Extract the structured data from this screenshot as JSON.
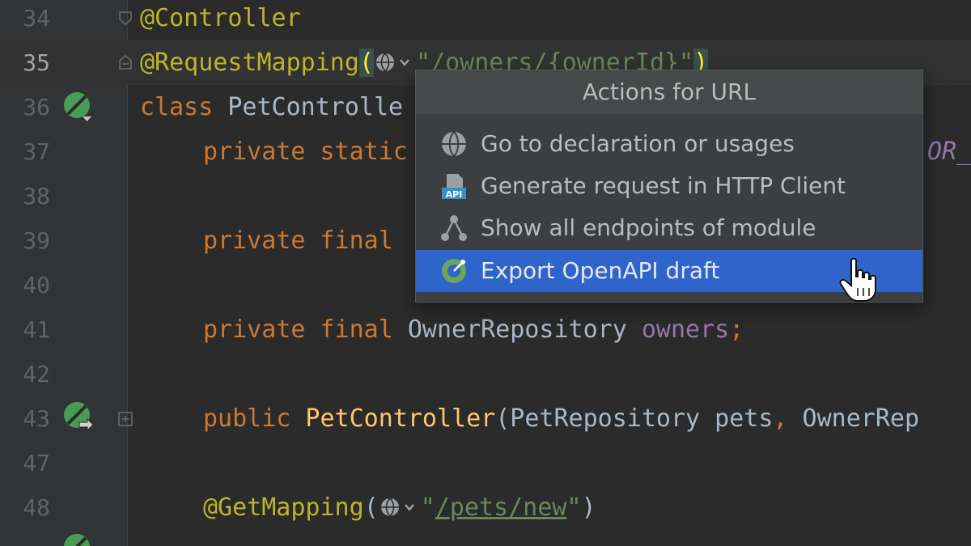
{
  "editor": {
    "lines": [
      {
        "num": "34",
        "t1": "@Controller"
      },
      {
        "num": "35",
        "t1": "@RequestMapping",
        "t2": "(",
        "t3": "\"",
        "url": "/owners/{ownerId}",
        "t4": "\"",
        "t5": ")"
      },
      {
        "num": "36",
        "t1": "class",
        "t2": " PetControlle"
      },
      {
        "num": "37",
        "t1": "private",
        "t2": " static",
        "tail": "OR_"
      },
      {
        "num": "38"
      },
      {
        "num": "39",
        "t1": "private",
        "t2": " final"
      },
      {
        "num": "40"
      },
      {
        "num": "41",
        "t1": "private",
        "t2": " final",
        "t3": " OwnerRepository ",
        "t4": "owners",
        "t5": ";"
      },
      {
        "num": "42"
      },
      {
        "num": "43",
        "t1": "public",
        "t2": " PetController",
        "t3": "(PetRepository pets",
        "t4": ",",
        "t5": " OwnerRep"
      },
      {
        "num": "47"
      },
      {
        "num": "48",
        "t1": "@GetMapping",
        "t2": "(",
        "t3": "\"",
        "url": "/pets/new",
        "t4": "\"",
        "t5": ")"
      }
    ]
  },
  "popup": {
    "title": "Actions for URL",
    "items": [
      {
        "label": "Go to declaration or usages",
        "icon": "globe-icon"
      },
      {
        "label": "Generate request in HTTP Client",
        "icon": "api-icon"
      },
      {
        "label": "Show all endpoints of module",
        "icon": "endpoints-graph-icon"
      },
      {
        "label": "Export OpenAPI draft",
        "icon": "openapi-icon",
        "selected": true
      }
    ]
  },
  "colors": {
    "background": "#2b2b2b",
    "gutter": "#313335",
    "keyword": "#cc7832",
    "annotation": "#bbb529",
    "string": "#6a8759",
    "field": "#9876aa",
    "method": "#ffc66d",
    "selection": "#2f65ca",
    "popup": "#3c3f41"
  }
}
